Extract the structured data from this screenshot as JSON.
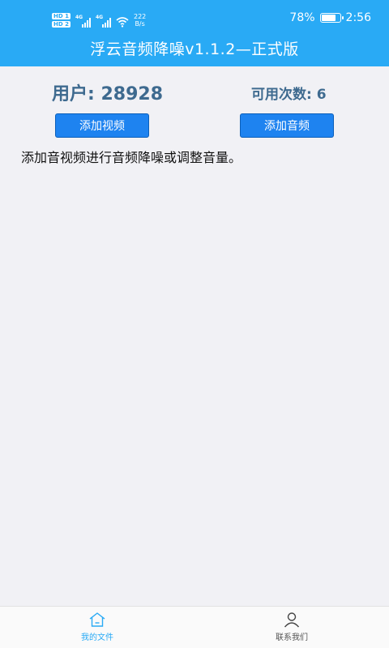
{
  "status_bar": {
    "sim1": "HD 1",
    "sim2": "HD 2",
    "network1": "4G",
    "network2": "4G",
    "net_speed_value": "222",
    "net_speed_unit": "B/s",
    "battery_percent": "78%",
    "battery_level": 0.78,
    "time": "2:56"
  },
  "header": {
    "title": "浮云音频降噪v1.1.2—正式版"
  },
  "user": {
    "label": "用户: 28928",
    "remaining_label": "可用次数: 6"
  },
  "actions": {
    "add_video": "添加视频",
    "add_audio": "添加音频"
  },
  "description": "添加音视频进行音频降噪或调整音量。",
  "bottom_nav": {
    "items": [
      {
        "label": "我的文件",
        "icon": "home-icon",
        "active": true
      },
      {
        "label": "联系我们",
        "icon": "person-icon",
        "active": false
      }
    ]
  },
  "colors": {
    "header_bg": "#29aaf5",
    "button_bg": "#1e83f0",
    "user_text": "#3e6a8f",
    "active_nav": "#29aaf5"
  }
}
